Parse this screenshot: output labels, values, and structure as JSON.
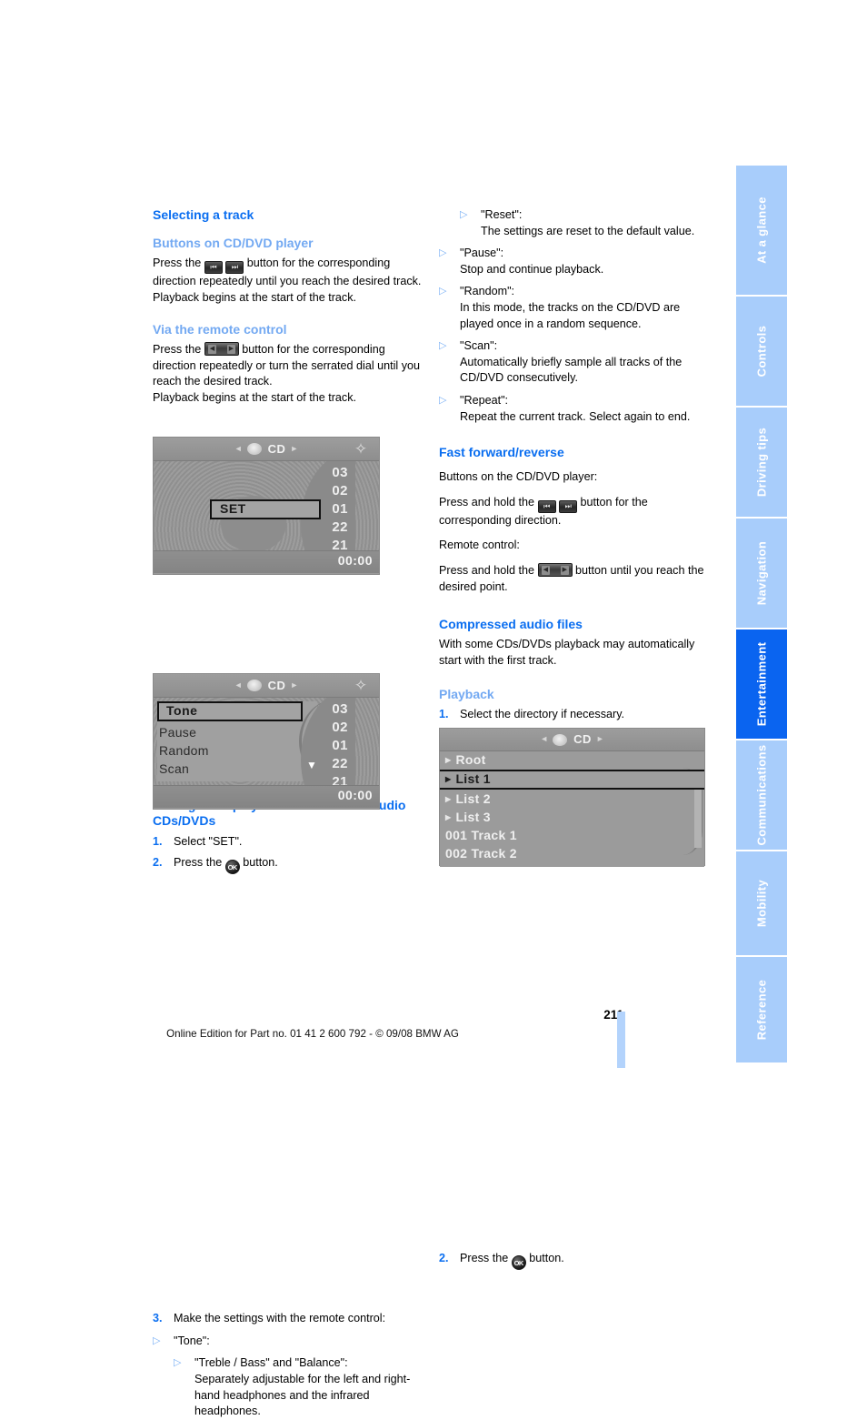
{
  "page": {
    "number": "211",
    "footer": "Online Edition for Part no. 01 41 2 600 792 - © 09/08 BMW AG",
    "heading_color": "#0a6ef0",
    "subheading_color": "#73a9f2",
    "tab_active_color": "#0a64f0",
    "tab_inactive_color": "#a8cdfb"
  },
  "tabs": [
    {
      "label": "At a glance",
      "active": false
    },
    {
      "label": "Controls",
      "active": false
    },
    {
      "label": "Driving tips",
      "active": false
    },
    {
      "label": "Navigation",
      "active": false
    },
    {
      "label": "Entertainment",
      "active": true
    },
    {
      "label": "Communications",
      "active": false
    },
    {
      "label": "Mobility",
      "active": false
    },
    {
      "label": "Reference",
      "active": false
    }
  ],
  "left_column": {
    "heading": "Selecting a track",
    "sub1": "Buttons on CD/DVD player",
    "sub1_p1_a": "Press the",
    "sub1_p1_b": "button for the corresponding direction repeatedly until you reach the desired track.",
    "sub1_p2": "Playback begins at the start of the track.",
    "sub2": "Via the remote control",
    "sub2_p1_a": "Press the",
    "sub2_p1_b": "button for the corresponding direction repeatedly or turn the serrated dial until you reach the desired track.",
    "sub2_p2": "Playback begins at the start of the track.",
    "heading2": "Settings and playback functions for audio CDs/DVDs",
    "step1_num": "1.",
    "step1_txt": "Select \"SET\".",
    "step2_num": "2.",
    "step2_txt_a": "Press the",
    "step2_txt_b": "button.",
    "step3_num": "3.",
    "step3_txt": "Make the settings with the remote control:",
    "bullet_tone": "\"Tone\":",
    "bullet_treble": "\"Treble / Bass\" and \"Balance\":\nSeparately adjustable for the left and right-hand headphones and the infrared headphones."
  },
  "right_column": {
    "bullet_reset": "\"Reset\":\nThe settings are reset to the default value.",
    "bullet_pause": "\"Pause\":\nStop and continue playback.",
    "bullet_random": "\"Random\":\nIn this mode, the tracks on the CD/DVD are played once in a random sequence.",
    "bullet_scan": "\"Scan\":\nAutomatically briefly sample all tracks of the CD/DVD consecutively.",
    "bullet_repeat": "\"Repeat\":\nRepeat the current track. Select again to end.",
    "heading_ff": "Fast forward/reverse",
    "ff_p1": "Buttons on the CD/DVD player:",
    "ff_p2_a": "Press and hold the",
    "ff_p2_b": "button for the corresponding direction.",
    "ff_p3": "Remote control:",
    "ff_p4_a": "Press and hold the",
    "ff_p4_b": "button until you reach the desired point.",
    "heading_caf": "Compressed audio files",
    "caf_p1": "With some CDs/DVDs playback may automatically start with the first track.",
    "sub_playback": "Playback",
    "pb_step1_num": "1.",
    "pb_step1_txt": "Select the directory if necessary.",
    "pb_step2_num": "2.",
    "pb_step2_txt_a": "Press the",
    "pb_step2_txt_b": "button."
  },
  "icons": {
    "prev_track": "prev-track-button-icon",
    "next_track": "next-track-button-icon",
    "rocker": "left-right-rocker-button-icon",
    "ok": "OK"
  },
  "screenshot_cd_set": {
    "source": "CD",
    "tracks": [
      "03",
      "02",
      "01",
      "22",
      "21"
    ],
    "selection": "SET",
    "time": "00:00"
  },
  "screenshot_cd_menu": {
    "source": "CD",
    "menu": [
      "Tone",
      "Pause",
      "Random",
      "Scan"
    ],
    "selected": "Tone",
    "tracks": [
      "03",
      "02",
      "01",
      "22",
      "21"
    ],
    "time": "00:00"
  },
  "screenshot_cd_list": {
    "source": "CD",
    "rows": [
      "Root",
      "List 1",
      "List 2",
      "List 3",
      "001 Track  1",
      "002 Track  2"
    ],
    "selected": "List 1"
  }
}
